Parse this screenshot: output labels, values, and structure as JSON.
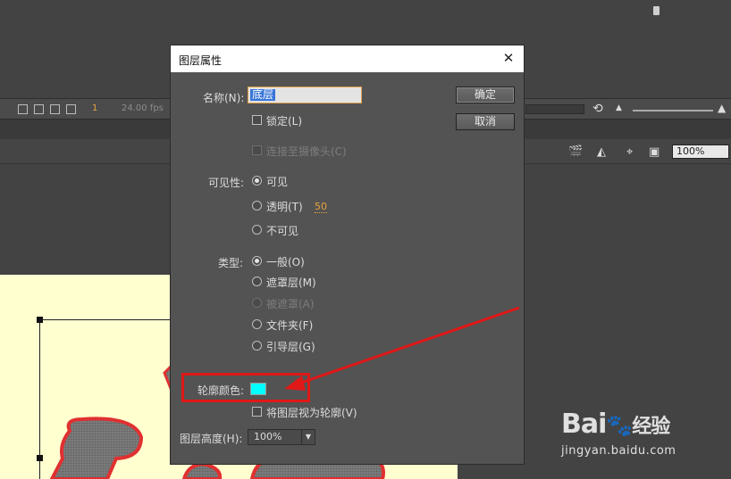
{
  "app": {
    "frame_number": "1",
    "frame_rate": "24.00 fps",
    "zoom_level": "100%"
  },
  "dialog": {
    "title": "图层属性",
    "name_label": "名称(N):",
    "name_value": "底层",
    "ok_label": "确定",
    "cancel_label": "取消",
    "lock_label": "锁定(L)",
    "camera_label": "连接至摄像头(C)",
    "visibility_label": "可见性:",
    "visibility_options": [
      "可见",
      "透明(T)",
      "不可见"
    ],
    "transparency_value": "50",
    "type_label": "类型:",
    "type_options": [
      "一般(O)",
      "遮罩层(M)",
      "被遮罩(A)",
      "文件夹(F)",
      "引导层(G)"
    ],
    "outline_color_label": "轮廓颜色:",
    "outline_color": "#00ffff",
    "view_as_outline_label": "将图层视为轮廓(V)",
    "height_label": "图层高度(H):",
    "height_value": "100%"
  },
  "colors": {
    "annotation": "#e01818",
    "stage": "#ffffd0",
    "shape_fill": "#7a7a7a",
    "shape_stroke": "#e03030"
  },
  "watermark": {
    "brand": "Bai",
    "brand_cn": "经验",
    "url": "jingyan.baidu.com"
  }
}
